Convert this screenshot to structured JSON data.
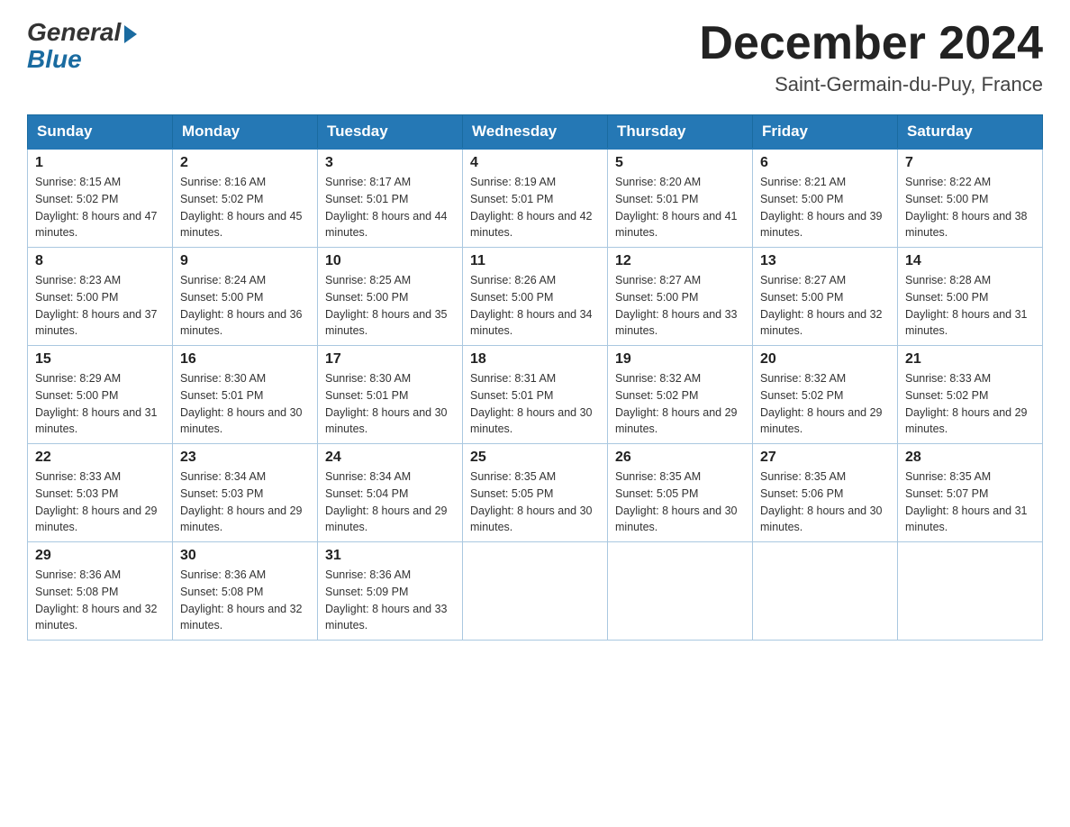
{
  "logo": {
    "general": "General",
    "blue": "Blue"
  },
  "title": "December 2024",
  "subtitle": "Saint-Germain-du-Puy, France",
  "days_of_week": [
    "Sunday",
    "Monday",
    "Tuesday",
    "Wednesday",
    "Thursday",
    "Friday",
    "Saturday"
  ],
  "weeks": [
    [
      {
        "day": "1",
        "sunrise": "8:15 AM",
        "sunset": "5:02 PM",
        "daylight": "8 hours and 47 minutes."
      },
      {
        "day": "2",
        "sunrise": "8:16 AM",
        "sunset": "5:02 PM",
        "daylight": "8 hours and 45 minutes."
      },
      {
        "day": "3",
        "sunrise": "8:17 AM",
        "sunset": "5:01 PM",
        "daylight": "8 hours and 44 minutes."
      },
      {
        "day": "4",
        "sunrise": "8:19 AM",
        "sunset": "5:01 PM",
        "daylight": "8 hours and 42 minutes."
      },
      {
        "day": "5",
        "sunrise": "8:20 AM",
        "sunset": "5:01 PM",
        "daylight": "8 hours and 41 minutes."
      },
      {
        "day": "6",
        "sunrise": "8:21 AM",
        "sunset": "5:00 PM",
        "daylight": "8 hours and 39 minutes."
      },
      {
        "day": "7",
        "sunrise": "8:22 AM",
        "sunset": "5:00 PM",
        "daylight": "8 hours and 38 minutes."
      }
    ],
    [
      {
        "day": "8",
        "sunrise": "8:23 AM",
        "sunset": "5:00 PM",
        "daylight": "8 hours and 37 minutes."
      },
      {
        "day": "9",
        "sunrise": "8:24 AM",
        "sunset": "5:00 PM",
        "daylight": "8 hours and 36 minutes."
      },
      {
        "day": "10",
        "sunrise": "8:25 AM",
        "sunset": "5:00 PM",
        "daylight": "8 hours and 35 minutes."
      },
      {
        "day": "11",
        "sunrise": "8:26 AM",
        "sunset": "5:00 PM",
        "daylight": "8 hours and 34 minutes."
      },
      {
        "day": "12",
        "sunrise": "8:27 AM",
        "sunset": "5:00 PM",
        "daylight": "8 hours and 33 minutes."
      },
      {
        "day": "13",
        "sunrise": "8:27 AM",
        "sunset": "5:00 PM",
        "daylight": "8 hours and 32 minutes."
      },
      {
        "day": "14",
        "sunrise": "8:28 AM",
        "sunset": "5:00 PM",
        "daylight": "8 hours and 31 minutes."
      }
    ],
    [
      {
        "day": "15",
        "sunrise": "8:29 AM",
        "sunset": "5:00 PM",
        "daylight": "8 hours and 31 minutes."
      },
      {
        "day": "16",
        "sunrise": "8:30 AM",
        "sunset": "5:01 PM",
        "daylight": "8 hours and 30 minutes."
      },
      {
        "day": "17",
        "sunrise": "8:30 AM",
        "sunset": "5:01 PM",
        "daylight": "8 hours and 30 minutes."
      },
      {
        "day": "18",
        "sunrise": "8:31 AM",
        "sunset": "5:01 PM",
        "daylight": "8 hours and 30 minutes."
      },
      {
        "day": "19",
        "sunrise": "8:32 AM",
        "sunset": "5:02 PM",
        "daylight": "8 hours and 29 minutes."
      },
      {
        "day": "20",
        "sunrise": "8:32 AM",
        "sunset": "5:02 PM",
        "daylight": "8 hours and 29 minutes."
      },
      {
        "day": "21",
        "sunrise": "8:33 AM",
        "sunset": "5:02 PM",
        "daylight": "8 hours and 29 minutes."
      }
    ],
    [
      {
        "day": "22",
        "sunrise": "8:33 AM",
        "sunset": "5:03 PM",
        "daylight": "8 hours and 29 minutes."
      },
      {
        "day": "23",
        "sunrise": "8:34 AM",
        "sunset": "5:03 PM",
        "daylight": "8 hours and 29 minutes."
      },
      {
        "day": "24",
        "sunrise": "8:34 AM",
        "sunset": "5:04 PM",
        "daylight": "8 hours and 29 minutes."
      },
      {
        "day": "25",
        "sunrise": "8:35 AM",
        "sunset": "5:05 PM",
        "daylight": "8 hours and 30 minutes."
      },
      {
        "day": "26",
        "sunrise": "8:35 AM",
        "sunset": "5:05 PM",
        "daylight": "8 hours and 30 minutes."
      },
      {
        "day": "27",
        "sunrise": "8:35 AM",
        "sunset": "5:06 PM",
        "daylight": "8 hours and 30 minutes."
      },
      {
        "day": "28",
        "sunrise": "8:35 AM",
        "sunset": "5:07 PM",
        "daylight": "8 hours and 31 minutes."
      }
    ],
    [
      {
        "day": "29",
        "sunrise": "8:36 AM",
        "sunset": "5:08 PM",
        "daylight": "8 hours and 32 minutes."
      },
      {
        "day": "30",
        "sunrise": "8:36 AM",
        "sunset": "5:08 PM",
        "daylight": "8 hours and 32 minutes."
      },
      {
        "day": "31",
        "sunrise": "8:36 AM",
        "sunset": "5:09 PM",
        "daylight": "8 hours and 33 minutes."
      },
      null,
      null,
      null,
      null
    ]
  ]
}
